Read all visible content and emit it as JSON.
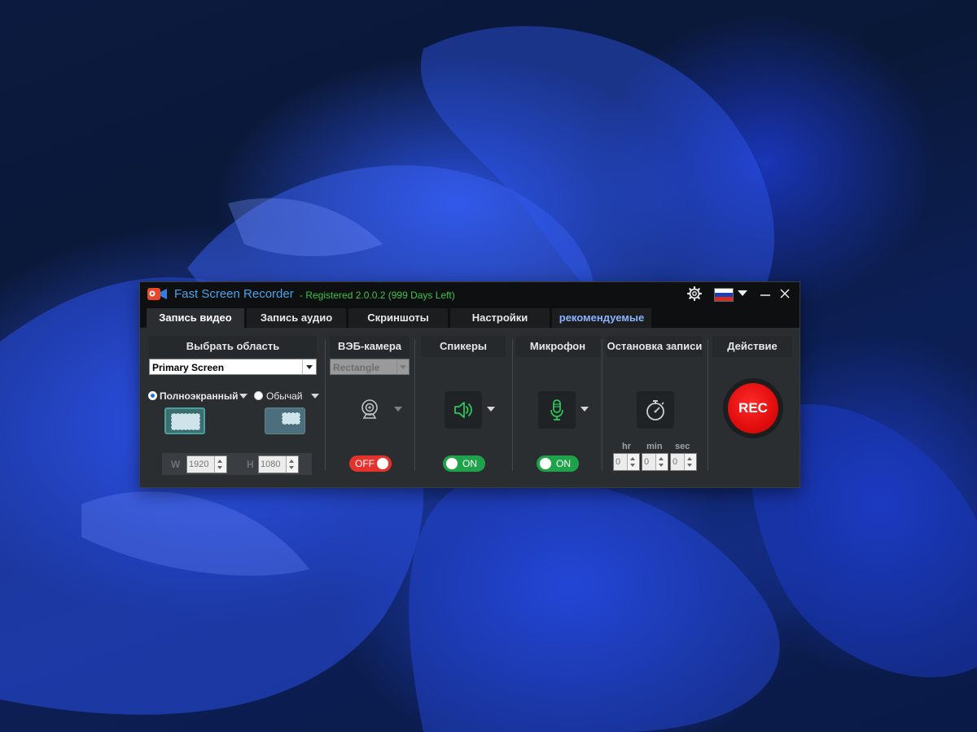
{
  "window": {
    "app_title": "Fast Screen Recorder",
    "registration": "- Registered 2.0.0.2 (999 Days Left)"
  },
  "tabs": [
    {
      "label": "Запись видео",
      "active": true
    },
    {
      "label": "Запись аудио",
      "active": false
    },
    {
      "label": "Скриншоты",
      "active": false
    },
    {
      "label": "Настройки",
      "active": false
    },
    {
      "label": "рекомендуемые",
      "active": false
    }
  ],
  "area": {
    "header": "Выбрать область",
    "selected": "Primary Screen",
    "mode_fullscreen": "Полноэкранный",
    "mode_normal": "Обычай",
    "width_label": "W",
    "width": "1920",
    "height_label": "H",
    "height": "1080"
  },
  "webcam": {
    "header": "ВЭБ-камера",
    "shape": "Rectangle",
    "toggle": "OFF"
  },
  "speakers": {
    "header": "Спикеры",
    "toggle": "ON"
  },
  "microphone": {
    "header": "Микрофон",
    "toggle": "ON"
  },
  "stop": {
    "header": "Остановка записи",
    "hr_label": "hr",
    "min_label": "min",
    "sec_label": "sec",
    "hr": "0",
    "min": "0",
    "sec": "0"
  },
  "action": {
    "header": "Действие",
    "rec_label": "REC"
  },
  "colors": {
    "accent_blue": "#4aa3e8",
    "registered_green": "#3ec34a",
    "toggle_on": "#1ea34a",
    "toggle_off": "#e4332d",
    "rec_red": "#e10d0d"
  },
  "icons": {
    "settings": "gear-icon",
    "language": "russia-flag-icon",
    "webcam": "webcam-icon",
    "speakers": "speaker-icon",
    "microphone": "microphone-icon",
    "timer": "stopwatch-icon"
  }
}
